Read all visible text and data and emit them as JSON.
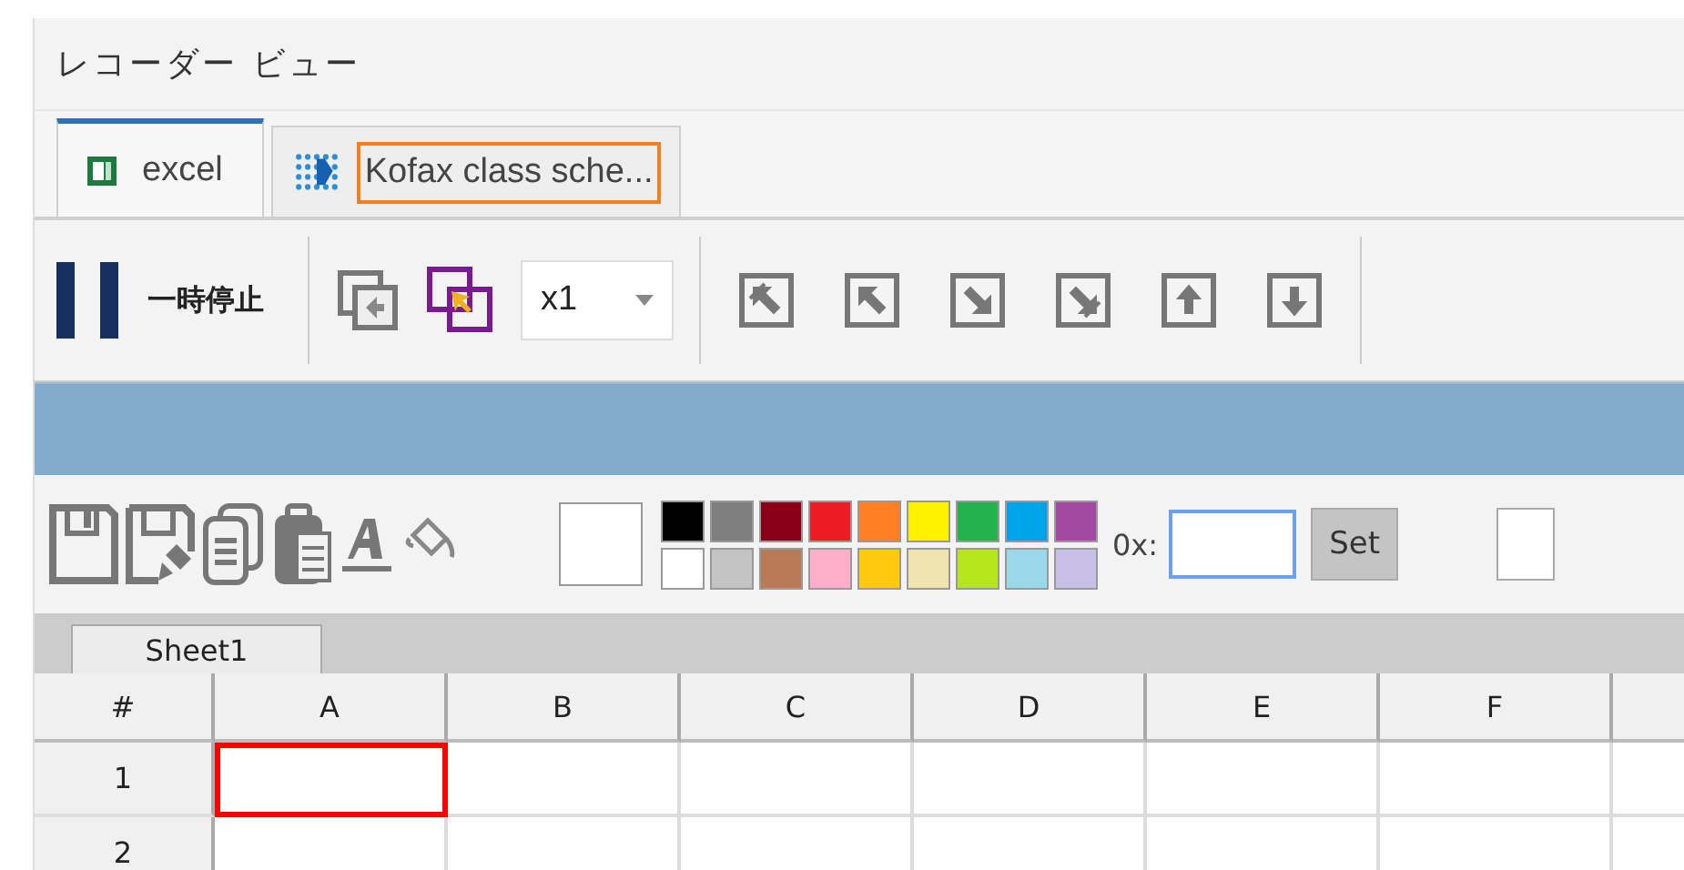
{
  "window": {
    "title": "レコーダー ビュー"
  },
  "tabs": [
    {
      "label": "excel",
      "kind": "sheet",
      "selected": true,
      "highlighted": false
    },
    {
      "label": "Kofax class sche...",
      "kind": "dots",
      "selected": false,
      "highlighted": true
    }
  ],
  "toolbar": {
    "pause_label": "一時停止",
    "speed": "x1"
  },
  "palette": {
    "current": {
      "color": "#ffffff"
    },
    "top": [
      {
        "color": "#000000"
      },
      {
        "color": "#7f7f7f"
      },
      {
        "color": "#880015"
      },
      {
        "color": "#ed1c24"
      },
      {
        "color": "#ff7f27"
      },
      {
        "color": "#fff200"
      },
      {
        "color": "#22b14c"
      },
      {
        "color": "#00a2e8"
      },
      {
        "color": "#a349a4"
      }
    ],
    "bottom": [
      {
        "color": "#ffffff"
      },
      {
        "color": "#c3c3c3"
      },
      {
        "color": "#b97a57"
      },
      {
        "color": "#ffaec9"
      },
      {
        "color": "#ffc90e"
      },
      {
        "color": "#efe4b0"
      },
      {
        "color": "#b5e61d"
      },
      {
        "color": "#99d9ea"
      },
      {
        "color": "#c8bfe7"
      }
    ],
    "hex_label": "0x:",
    "set_button": "Set"
  },
  "sheet_tabs": [
    {
      "label": "Sheet1",
      "selected": true
    }
  ],
  "grid": {
    "corner": "#",
    "columns": [
      "A",
      "B",
      "C",
      "D",
      "E",
      "F"
    ],
    "rows": [
      {
        "header": "1",
        "cells": [
          {
            "selected": true
          },
          {
            "selected": false
          },
          {
            "selected": false
          },
          {
            "selected": false
          },
          {
            "selected": false
          },
          {
            "selected": false
          }
        ]
      },
      {
        "header": "2",
        "cells": [
          {
            "selected": false
          },
          {
            "selected": false
          },
          {
            "selected": false
          },
          {
            "selected": false
          },
          {
            "selected": false
          },
          {
            "selected": false
          }
        ]
      }
    ]
  }
}
